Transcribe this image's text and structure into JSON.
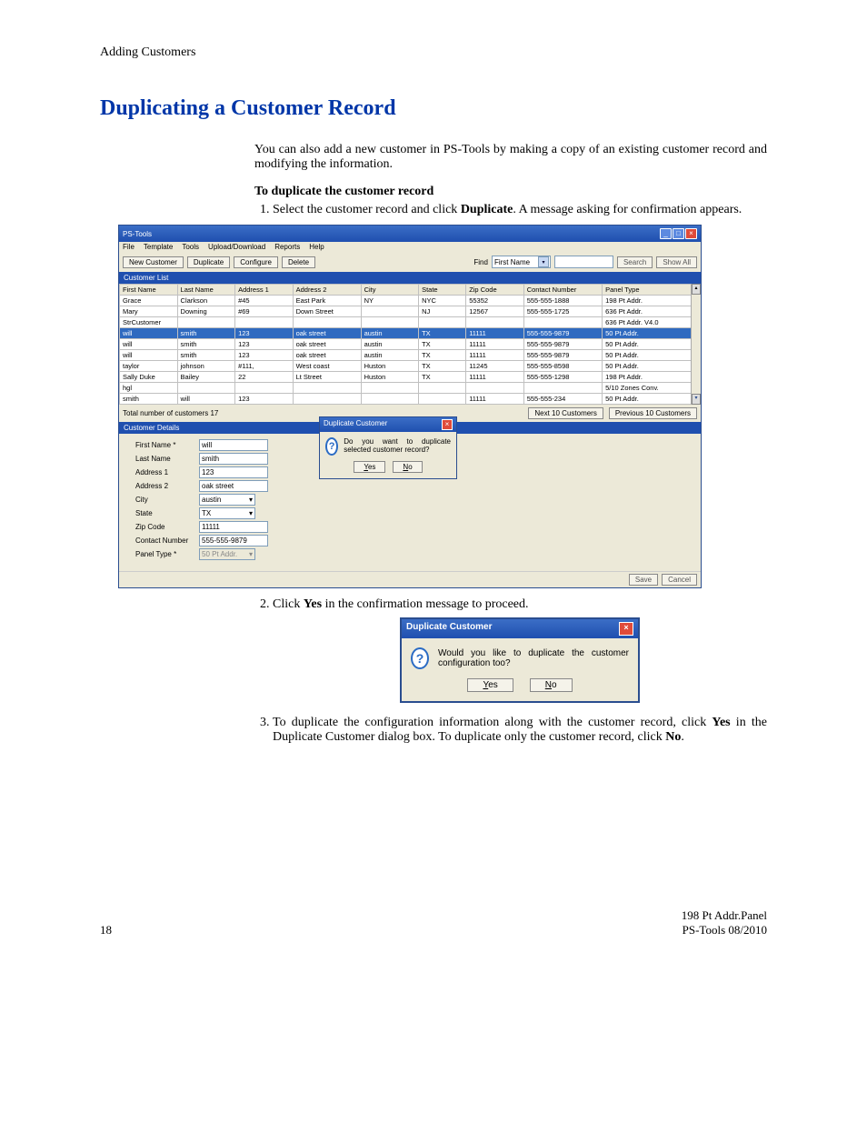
{
  "page": {
    "section_header": "Adding Customers",
    "title": "Duplicating a Customer Record",
    "intro": "You can also add a new customer in PS-Tools by making a copy of an existing customer record and modifying the information.",
    "procedure_heading": "To duplicate the customer record",
    "step1_pre": "Select the customer record and click ",
    "step1_bold": "Duplicate",
    "step1_post": ". A message asking for confirmation appears.",
    "step2_pre": "Click ",
    "step2_bold": "Yes",
    "step2_post": " in the confirmation message to proceed.",
    "step3_pre": "To duplicate the configuration information along with the customer record, click ",
    "step3_bold1": "Yes",
    "step3_mid": " in the Duplicate Customer dialog box. To duplicate only the customer record, click ",
    "step3_bold2": "No",
    "step3_post": ".",
    "footer_page": "18",
    "footer_right1": "198 Pt Addr.Panel",
    "footer_right2": "PS-Tools 08/2010"
  },
  "app": {
    "title": "PS-Tools",
    "menu": [
      "File",
      "Template",
      "Tools",
      "Upload/Download",
      "Reports",
      "Help"
    ],
    "toolbar": {
      "new": "New Customer",
      "duplicate": "Duplicate",
      "configure": "Configure",
      "delete": "Delete",
      "find_label": "Find",
      "find_field": "First Name",
      "search": "Search",
      "show_all": "Show All"
    },
    "list_header": "Customer List",
    "columns": [
      "First Name",
      "Last Name",
      "Address 1",
      "Address 2",
      "City",
      "State",
      "Zip Code",
      "Contact Number",
      "Panel Type"
    ],
    "rows": [
      {
        "c": [
          "Grace",
          "Clarkson",
          "#45",
          "East Park",
          "NY",
          "NYC",
          "55352",
          "555-555-1888",
          "198 Pt Addr."
        ]
      },
      {
        "c": [
          "Mary",
          "Downing",
          "#69",
          "Down Street",
          "",
          "NJ",
          "12567",
          "555-555-1725",
          "636 Pt Addr."
        ]
      },
      {
        "c": [
          "StrCustomer",
          "",
          "",
          "",
          "",
          "",
          "",
          "",
          "636 Pt Addr. V4.0"
        ]
      },
      {
        "c": [
          "will",
          "smith",
          "123",
          "oak street",
          "austin",
          "TX",
          "11111",
          "555-555-9879",
          "50 Pt Addr."
        ],
        "sel": true
      },
      {
        "c": [
          "will",
          "smith",
          "123",
          "oak street",
          "austin",
          "TX",
          "11111",
          "555-555-9879",
          "50 Pt Addr."
        ]
      },
      {
        "c": [
          "will",
          "smith",
          "123",
          "oak street",
          "austin",
          "TX",
          "11111",
          "555-555-9879",
          "50 Pt Addr."
        ]
      },
      {
        "c": [
          "taylor",
          "johnson",
          "#111,",
          "West coast",
          "Huston",
          "TX",
          "11245",
          "555-555-8598",
          "50 Pt Addr."
        ]
      },
      {
        "c": [
          "Sally Duke",
          "Bailey",
          "22",
          "Lt Street",
          "Huston",
          "TX",
          "11111",
          "555-555-1298",
          "198 Pt Addr."
        ]
      },
      {
        "c": [
          "hgl",
          "",
          "",
          "",
          "",
          "",
          "",
          "",
          "5/10 Zones Conv."
        ]
      },
      {
        "c": [
          "smith",
          "will",
          "123",
          "",
          "",
          "",
          "11111",
          "555-555-234",
          "50 Pt Addr."
        ]
      }
    ],
    "total_label": "Total number of customers 17",
    "next_btn": "Next 10 Customers",
    "prev_btn": "Previous 10 Customers",
    "details_header": "Customer Details",
    "details": {
      "first_name_lbl": "First Name *",
      "first_name": "will",
      "last_name_lbl": "Last Name",
      "last_name": "smith",
      "addr1_lbl": "Address 1",
      "addr1": "123",
      "addr2_lbl": "Address 2",
      "addr2": "oak street",
      "city_lbl": "City",
      "city": "austin",
      "state_lbl": "State",
      "state": "TX",
      "zip_lbl": "Zip Code",
      "zip": "11111",
      "contact_lbl": "Contact Number",
      "contact": "555-555-9879",
      "panel_lbl": "Panel Type *",
      "panel": "50 Pt Addr."
    },
    "footer": {
      "save": "Save",
      "cancel": "Cancel"
    },
    "modal1": {
      "title": "Duplicate Customer",
      "msg": "Do you want to duplicate selected customer record?",
      "yes": "Yes",
      "no": "No"
    }
  },
  "dialog2": {
    "title": "Duplicate Customer",
    "msg": "Would you like to duplicate the customer configuration too?",
    "yes": "Yes",
    "no": "No"
  }
}
